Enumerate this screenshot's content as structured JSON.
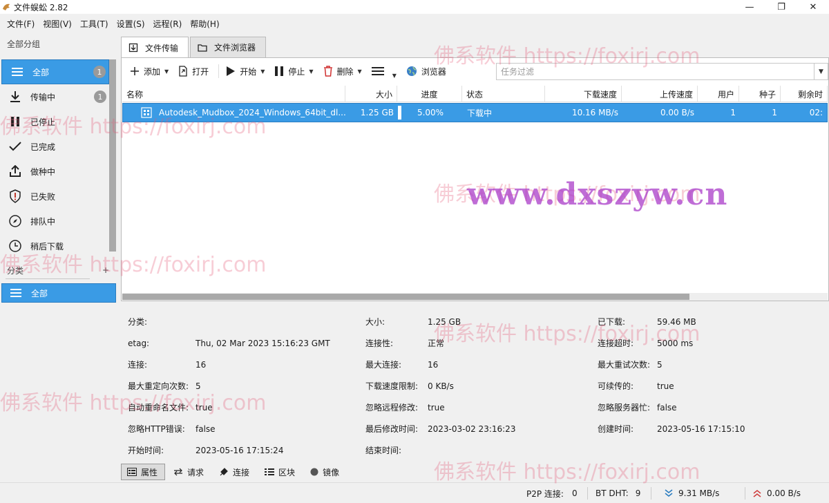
{
  "window": {
    "title": "文件蜈蚣 2.82",
    "controls": [
      "—",
      "❐",
      "✕"
    ]
  },
  "menu": [
    "文件(F)",
    "视图(V)",
    "工具(T)",
    "设置(S)",
    "远程(R)",
    "帮助(H)"
  ],
  "sidebar": {
    "group_header": "全部分组",
    "items": [
      {
        "label": "全部",
        "icon": "list-icon",
        "badge": "1",
        "active": true
      },
      {
        "label": "传输中",
        "icon": "download-icon",
        "badge": "1"
      },
      {
        "label": "已停止",
        "icon": "pause-icon"
      },
      {
        "label": "已完成",
        "icon": "check-icon"
      },
      {
        "label": "做种中",
        "icon": "upload-icon"
      },
      {
        "label": "已失败",
        "icon": "warning-shield-icon"
      },
      {
        "label": "排队中",
        "icon": "compass-icon"
      },
      {
        "label": "稍后下载",
        "icon": "clock-icon"
      }
    ],
    "category_header": "分类",
    "category_add": "+",
    "category_item": "全部"
  },
  "tabs": [
    {
      "label": "文件传输",
      "icon": "transfer-icon",
      "active": true
    },
    {
      "label": "文件浏览器",
      "icon": "folder-icon"
    }
  ],
  "toolbar": {
    "add": "添加",
    "open": "打开",
    "start": "开始",
    "stop": "停止",
    "delete": "删除",
    "browser": "浏览器",
    "filter_placeholder": "任务过滤"
  },
  "table": {
    "columns": [
      "名称",
      "大小",
      "进度",
      "状态",
      "下载速度",
      "上传速度",
      "用户",
      "种子",
      "剩余时"
    ],
    "rows": [
      {
        "name": "Autodesk_Mudbox_2024_Windows_64bit_dl...",
        "size": "1.25 GB",
        "progress": "5.00%",
        "progress_value": 0.05,
        "status": "下载中",
        "down_speed": "10.16 MB/s",
        "up_speed": "0.00 B/s",
        "users": "1",
        "seeds": "1",
        "remaining": "02:"
      }
    ]
  },
  "details": {
    "col1": [
      {
        "label": "分类:",
        "value": ""
      },
      {
        "label": "etag:",
        "value": "Thu, 02 Mar 2023 15:16:23 GMT"
      },
      {
        "label": "连接:",
        "value": "16"
      },
      {
        "label": "最大重定向次数:",
        "value": "5"
      },
      {
        "label": "自动重命名文件:",
        "value": "true"
      },
      {
        "label": "忽略HTTP错误:",
        "value": "false"
      },
      {
        "label": "开始时间:",
        "value": "2023-05-16 17:15:24"
      }
    ],
    "col2": [
      {
        "label": "大小:",
        "value": "1.25 GB"
      },
      {
        "label": "连接性:",
        "value": "正常"
      },
      {
        "label": "最大连接:",
        "value": "16"
      },
      {
        "label": "下载速度限制:",
        "value": "0 KB/s"
      },
      {
        "label": "忽略远程修改:",
        "value": "true"
      },
      {
        "label": "最后修改时间:",
        "value": "2023-03-02 23:16:23"
      },
      {
        "label": "结束时间:",
        "value": ""
      }
    ],
    "col3": [
      {
        "label": "已下载:",
        "value": "59.46 MB"
      },
      {
        "label": "连接超时:",
        "value": "5000 ms"
      },
      {
        "label": "最大重试次数:",
        "value": "5"
      },
      {
        "label": "可续传的:",
        "value": "true"
      },
      {
        "label": "忽略服务器忙:",
        "value": "false"
      },
      {
        "label": "创建时间:",
        "value": "2023-05-16 17:15:10"
      }
    ]
  },
  "bottom_tabs": [
    "属性",
    "请求",
    "连接",
    "区块",
    "镜像"
  ],
  "statusbar": {
    "p2p_label": "P2P 连接:",
    "p2p_value": "0",
    "dht_label": "BT DHT:",
    "dht_value": "9",
    "down_speed": "9.31 MB/s",
    "up_speed": "0.00 B/s"
  },
  "watermarks": {
    "small": "佛系软件 https://foxirj.com",
    "big": "www.dxszyw.cn"
  },
  "colors": {
    "selection": "#3a9be5",
    "badge": "#9a9a9a",
    "down_arrow": "#2a7cc0",
    "up_arrow": "#d04040"
  }
}
